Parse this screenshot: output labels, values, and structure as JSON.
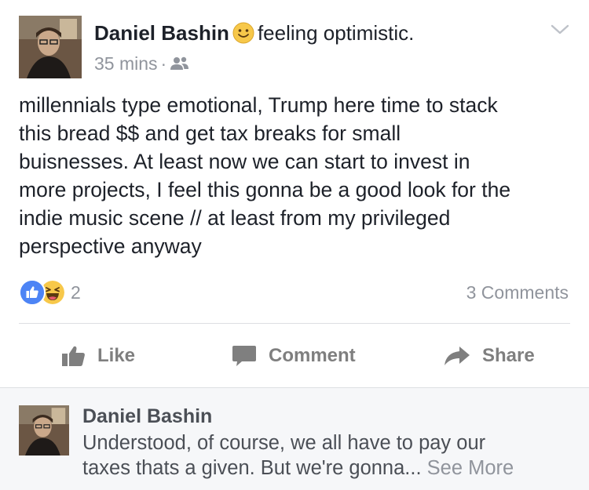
{
  "post": {
    "author": "Daniel Bashin",
    "feeling": "feeling optimistic.",
    "feeling_icon": "smiley-emoji-icon",
    "time": "35 mins",
    "separator": "·",
    "audience_icon": "friends-icon",
    "text_lines": [
      "millennials type emotional, Trump here time to stack",
      "this bread $$ and get  tax breaks for small",
      "buisnesses. At least now we can start to invest in",
      "more projects,  I feel this gonna be a good look for the",
      "indie music scene // at least from my privileged",
      "perspective anyway"
    ]
  },
  "reactions": {
    "icons": [
      "like-reaction-icon",
      "haha-reaction-icon"
    ],
    "count": "2",
    "comments_count": "3 Comments"
  },
  "actions": {
    "like": "Like",
    "comment": "Comment",
    "share": "Share"
  },
  "comment": {
    "author": "Daniel Bashin",
    "text_line1": "Understood, of course, we all have to pay our",
    "text_line2": "taxes thats a given. But we're gonna...",
    "see_more": "See More"
  },
  "colors": {
    "facebook_blue": "#4d84f5",
    "text_primary": "#1d2129",
    "text_secondary": "#90949c",
    "action_gray": "#7f7f7f",
    "comment_bg": "#f6f7f9",
    "emoji_yellow": "#f7c84a"
  }
}
